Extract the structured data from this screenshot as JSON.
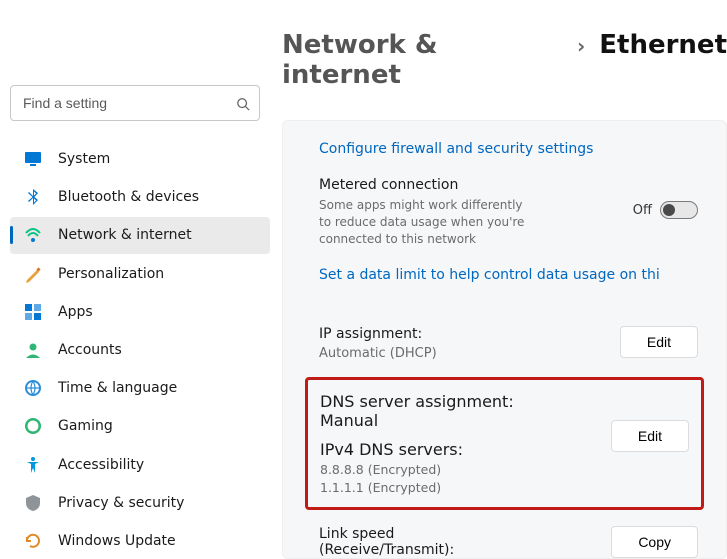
{
  "search": {
    "placeholder": "Find a setting"
  },
  "sidebar": {
    "items": [
      {
        "label": "System"
      },
      {
        "label": "Bluetooth & devices"
      },
      {
        "label": "Network & internet"
      },
      {
        "label": "Personalization"
      },
      {
        "label": "Apps"
      },
      {
        "label": "Accounts"
      },
      {
        "label": "Time & language"
      },
      {
        "label": "Gaming"
      },
      {
        "label": "Accessibility"
      },
      {
        "label": "Privacy & security"
      },
      {
        "label": "Windows Update"
      }
    ]
  },
  "breadcrumb": {
    "parent": "Network & internet",
    "chevron": "›",
    "current": "Ethernet"
  },
  "links": {
    "firewall": "Configure firewall and security settings",
    "data_limit": "Set a data limit to help control data usage on thi"
  },
  "metered": {
    "title": "Metered connection",
    "desc": "Some apps might work differently to reduce data usage when you're connected to this network",
    "state_label": "Off"
  },
  "ip": {
    "label": "IP assignment:",
    "value": "Automatic (DHCP)",
    "edit": "Edit"
  },
  "dns": {
    "label": "DNS server assignment:",
    "value": "Manual",
    "v4label": "IPv4 DNS servers:",
    "server1": "8.8.8.8 (Encrypted)",
    "server2": "1.1.1.1 (Encrypted)",
    "edit": "Edit"
  },
  "link": {
    "label": "Link speed (Receive/Transmit):",
    "copy": "Copy"
  }
}
